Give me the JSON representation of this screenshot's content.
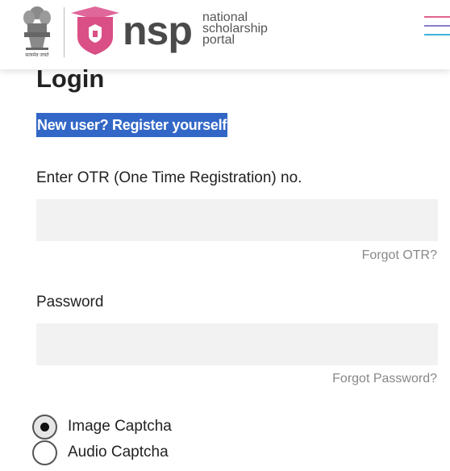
{
  "header": {
    "emblem_caption": "सत्यमेव जयते",
    "logo_text": "nsp",
    "logo_subtitle": [
      "national",
      "scholarship",
      "portal"
    ],
    "menu_colors": [
      "#e0638d",
      "#8a7cc8",
      "#3fb3d9"
    ]
  },
  "login": {
    "title": "Login",
    "register_link": "New user? Register yourself",
    "otr_label": "Enter OTR (One Time Registration) no.",
    "otr_value": "",
    "forgot_otr": "Forgot OTR?",
    "password_label": "Password",
    "password_value": "",
    "forgot_password": "Forgot Password?",
    "captcha_options": [
      {
        "label": "Image Captcha",
        "selected": true
      },
      {
        "label": "Audio Captcha",
        "selected": false
      }
    ]
  }
}
